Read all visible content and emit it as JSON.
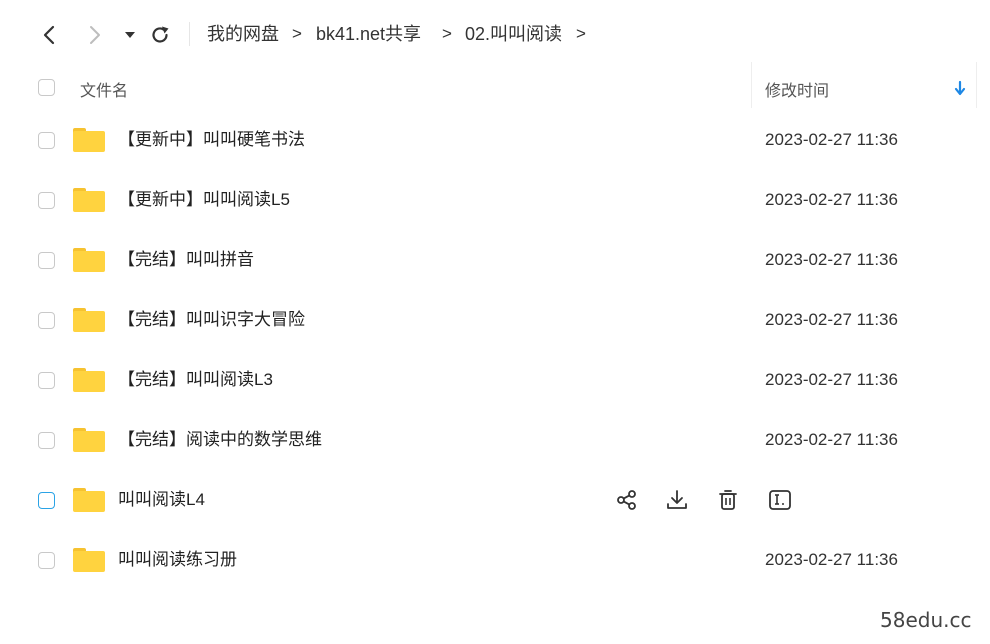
{
  "breadcrumb": {
    "root": "我的网盘",
    "level1": "bk41.net共享",
    "level2": "02.叫叫阅读",
    "separator": ">"
  },
  "header": {
    "name_label": "文件名",
    "time_label": "修改时间"
  },
  "rows": [
    {
      "name": "【更新中】叫叫硬笔书法",
      "time": "2023-02-27 11:36"
    },
    {
      "name": "【更新中】叫叫阅读L5",
      "time": "2023-02-27 11:36"
    },
    {
      "name": "【完结】叫叫拼音",
      "time": "2023-02-27 11:36"
    },
    {
      "name": "【完结】叫叫识字大冒险",
      "time": "2023-02-27 11:36"
    },
    {
      "name": "【完结】叫叫阅读L3",
      "time": "2023-02-27 11:36"
    },
    {
      "name": "【完结】阅读中的数学思维",
      "time": "2023-02-27 11:36"
    },
    {
      "name": "叫叫阅读L4",
      "time": ""
    },
    {
      "name": "叫叫阅读练习册",
      "time": "2023-02-27 11:36"
    }
  ],
  "icons": {
    "back": "chevron-left-icon",
    "forward": "chevron-right-icon",
    "history": "caret-down-icon",
    "refresh": "refresh-icon",
    "sort": "arrow-down-icon",
    "share": "share-icon",
    "download": "download-icon",
    "delete": "trash-icon",
    "rename": "rename-icon",
    "folder": "folder-icon"
  },
  "colors": {
    "accent": "#1e88e5",
    "folder": "#ffd33f",
    "checkbox_hover": "#2aa3e6"
  },
  "watermark": "58edu.cc"
}
